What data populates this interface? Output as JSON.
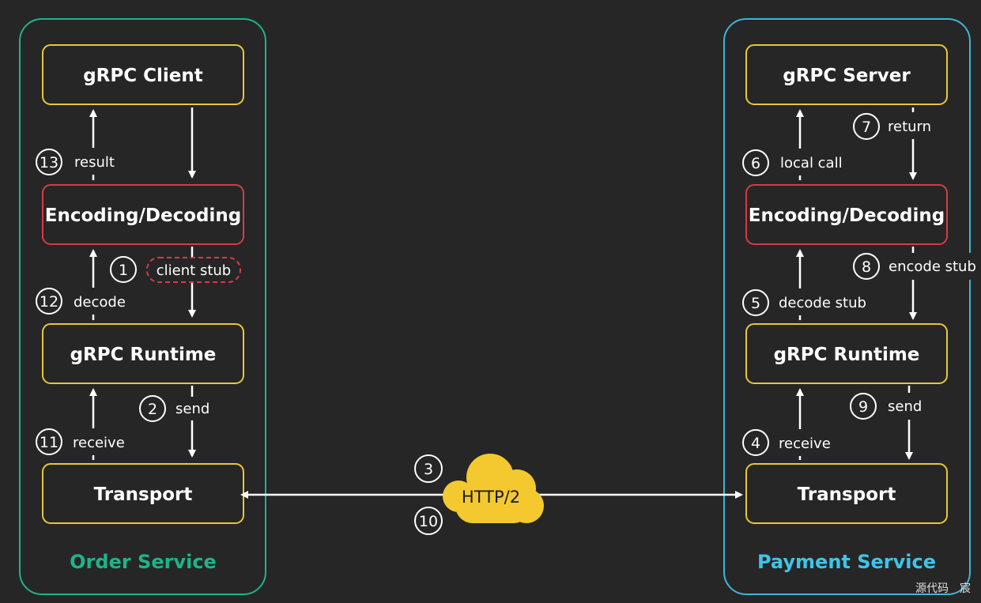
{
  "colors": {
    "background": "#262626",
    "order_border": "#1fb38a",
    "payment_border": "#3fb5d8",
    "yellow_box": "#e8c63a",
    "red_box": "#d63a4a",
    "cloud": "#f4c92f",
    "order_label": "#1fb38a",
    "payment_label": "#3fc4ea"
  },
  "order_service": {
    "label": "Order Service",
    "boxes": {
      "client": "gRPC Client",
      "codec": "Encoding/Decoding",
      "runtime": "gRPC Runtime",
      "transport": "Transport"
    },
    "steps": {
      "s1": {
        "num": "1",
        "label": "client stub"
      },
      "s2": {
        "num": "2",
        "label": "send"
      },
      "s11": {
        "num": "11",
        "label": "receive"
      },
      "s12": {
        "num": "12",
        "label": "decode"
      },
      "s13": {
        "num": "13",
        "label": "result"
      }
    }
  },
  "payment_service": {
    "label": "Payment Service",
    "boxes": {
      "server": "gRPC Server",
      "codec": "Encoding/Decoding",
      "runtime": "gRPC Runtime",
      "transport": "Transport"
    },
    "steps": {
      "s4": {
        "num": "4",
        "label": "receive"
      },
      "s5": {
        "num": "5",
        "label": "decode stub"
      },
      "s6": {
        "num": "6",
        "label": "local call"
      },
      "s7": {
        "num": "7",
        "label": "return"
      },
      "s8": {
        "num": "8",
        "label": "encode stub"
      },
      "s9": {
        "num": "9",
        "label": "send"
      }
    }
  },
  "network": {
    "protocol": "HTTP/2",
    "step_out": "3",
    "step_back": "10"
  },
  "watermark": "源代码　宸"
}
